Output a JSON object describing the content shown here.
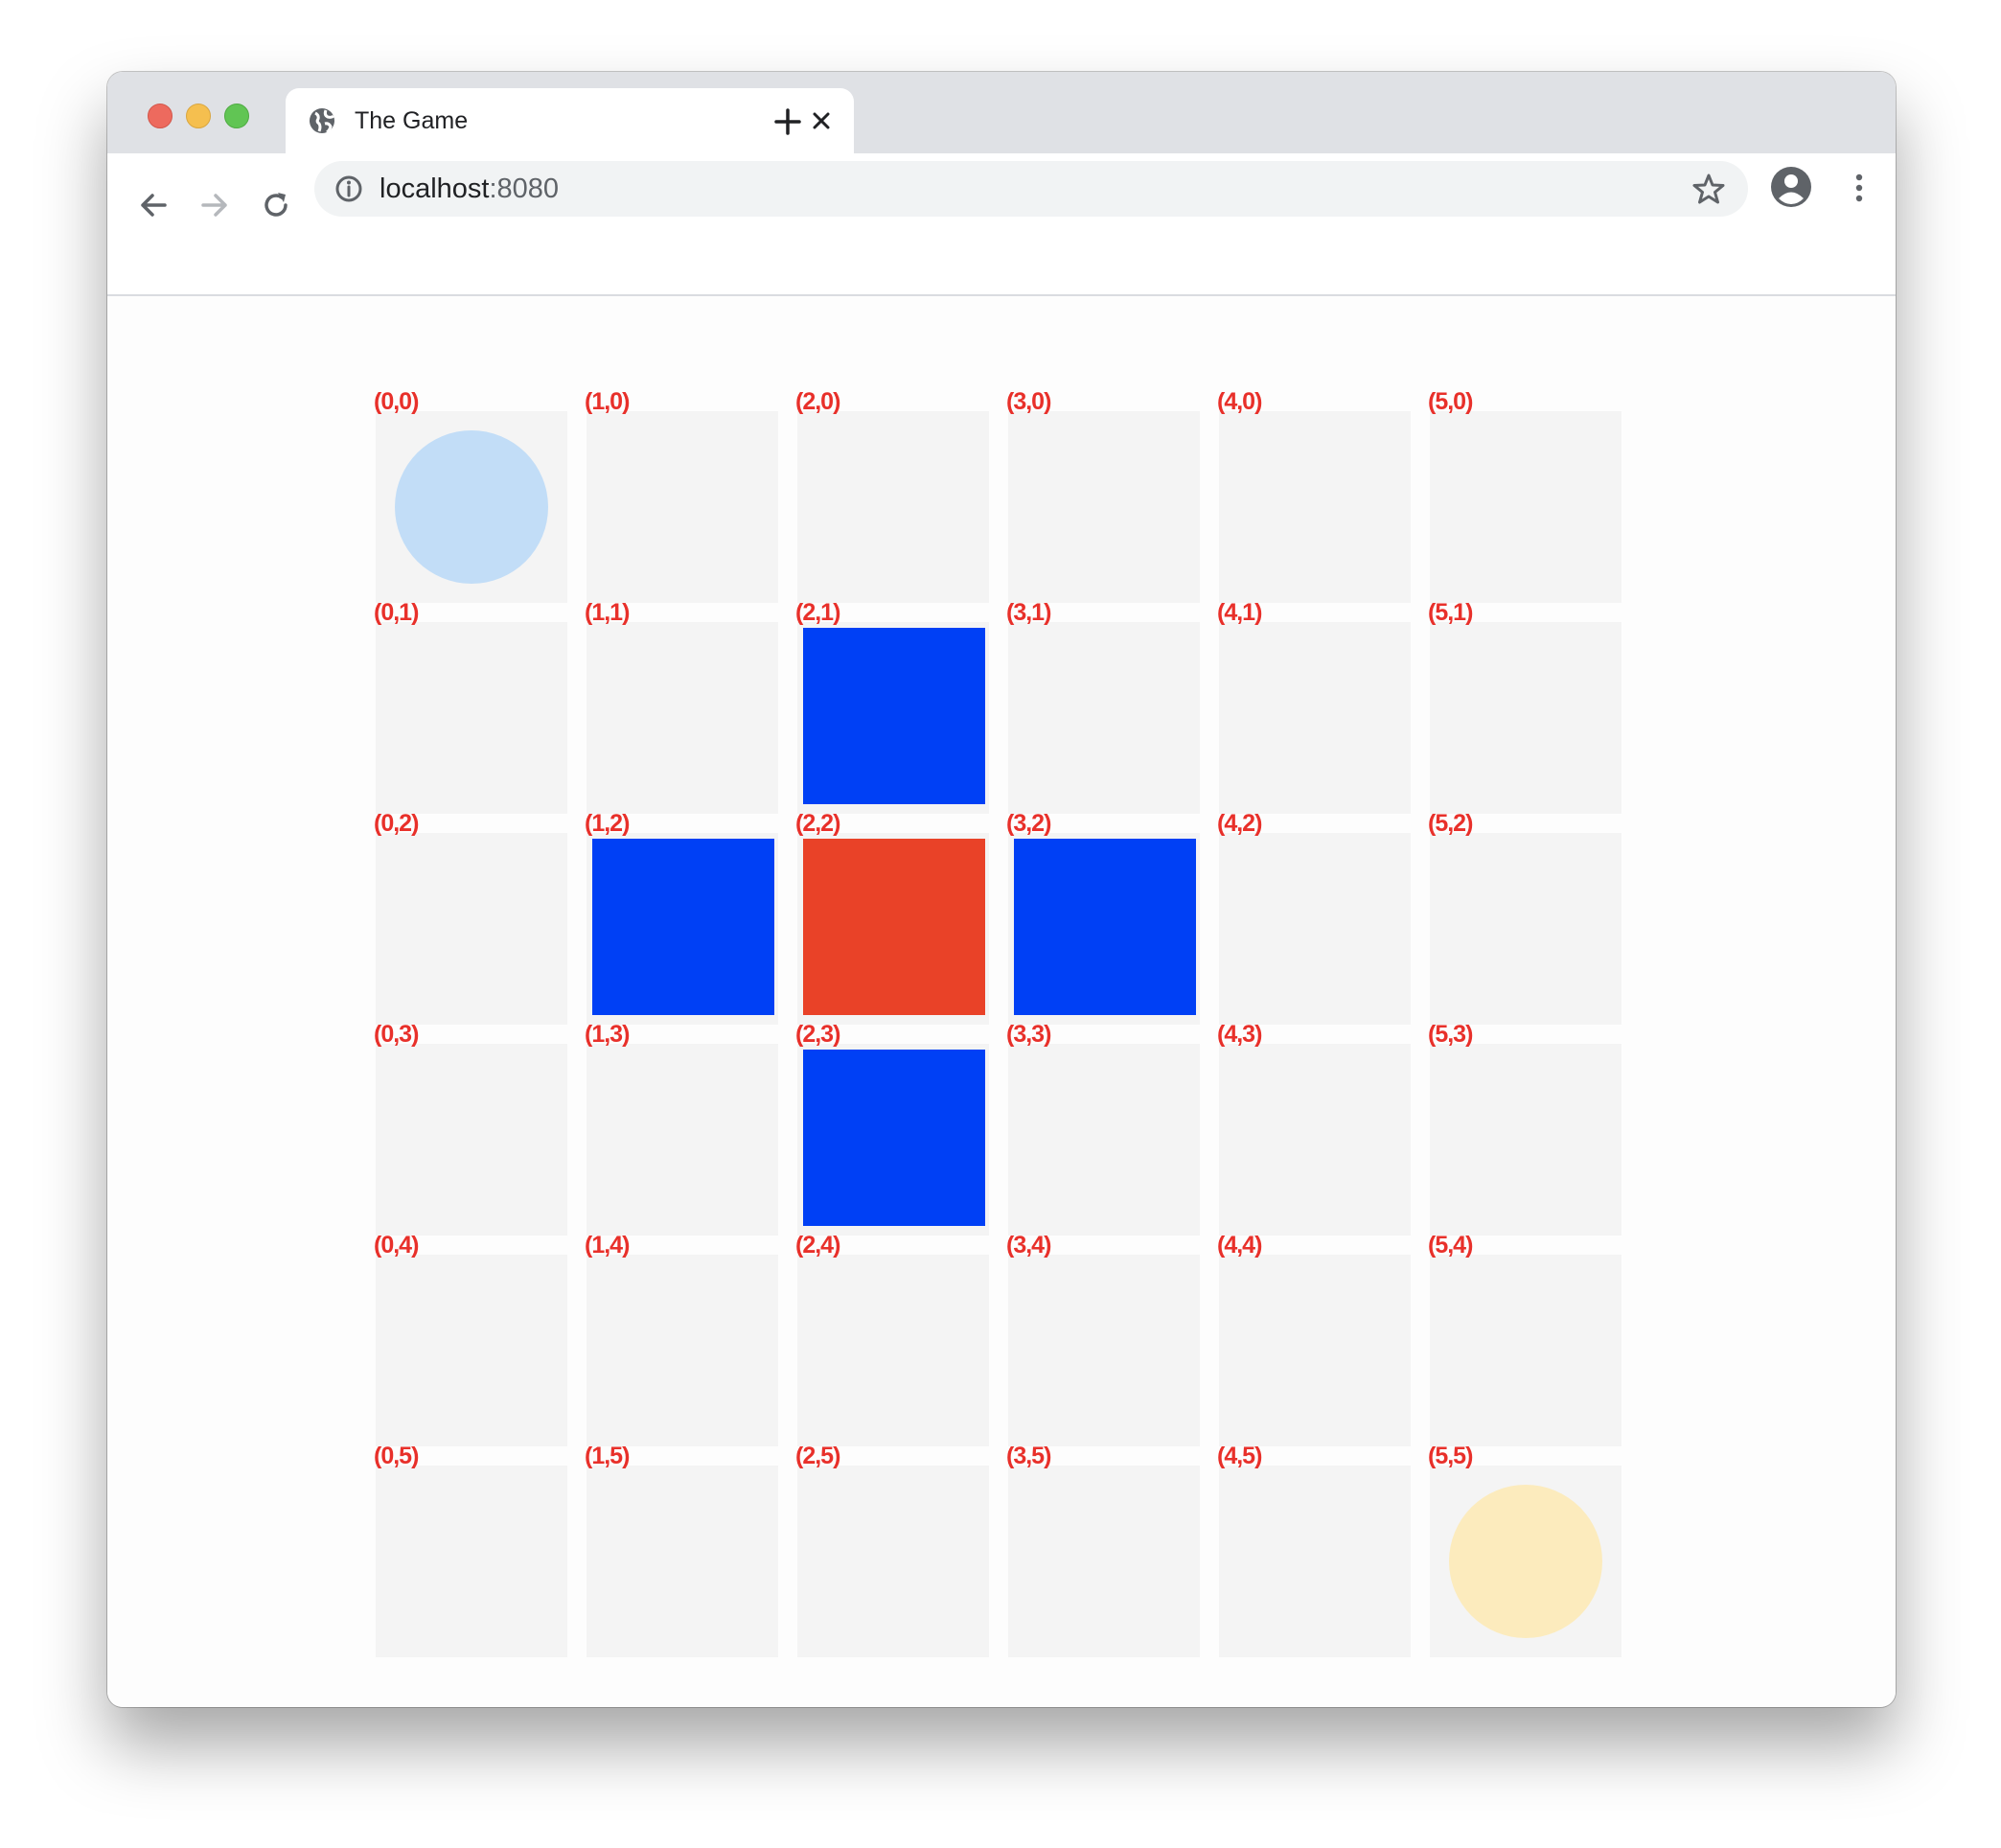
{
  "browser": {
    "tab_title": "The Game",
    "url_host": "localhost",
    "url_port": ":8080"
  },
  "game": {
    "columns": 6,
    "rows": 6,
    "coordinate_labels": [
      [
        "(0,0)",
        "(1,0)",
        "(2,0)",
        "(3,0)",
        "(4,0)",
        "(5,0)"
      ],
      [
        "(0,1)",
        "(1,1)",
        "(2,1)",
        "(3,1)",
        "(4,1)",
        "(5,1)"
      ],
      [
        "(0,2)",
        "(1,2)",
        "(2,2)",
        "(3,2)",
        "(4,2)",
        "(5,2)"
      ],
      [
        "(0,3)",
        "(1,3)",
        "(2,3)",
        "(3,3)",
        "(4,3)",
        "(5,3)"
      ],
      [
        "(0,4)",
        "(1,4)",
        "(2,4)",
        "(3,4)",
        "(4,4)",
        "(5,4)"
      ],
      [
        "(0,5)",
        "(1,5)",
        "(2,5)",
        "(3,5)",
        "(4,5)",
        "(5,5)"
      ]
    ],
    "pieces": [
      {
        "name": "blue-circle-piece",
        "shape": "circle",
        "col": 0,
        "row": 0,
        "color": "#c2ddf7"
      },
      {
        "name": "yellow-circle-piece",
        "shape": "circle",
        "col": 5,
        "row": 5,
        "color": "#fcebbd"
      },
      {
        "name": "red-square-piece",
        "shape": "square",
        "col": 2,
        "row": 2,
        "color": "#e94228"
      },
      {
        "name": "blue-square-piece",
        "shape": "square",
        "col": 2,
        "row": 1,
        "color": "#0040f5"
      },
      {
        "name": "blue-square-piece",
        "shape": "square",
        "col": 1,
        "row": 2,
        "color": "#0040f5"
      },
      {
        "name": "blue-square-piece",
        "shape": "square",
        "col": 3,
        "row": 2,
        "color": "#0040f5"
      },
      {
        "name": "blue-square-piece",
        "shape": "square",
        "col": 2,
        "row": 3,
        "color": "#0040f5"
      }
    ]
  }
}
